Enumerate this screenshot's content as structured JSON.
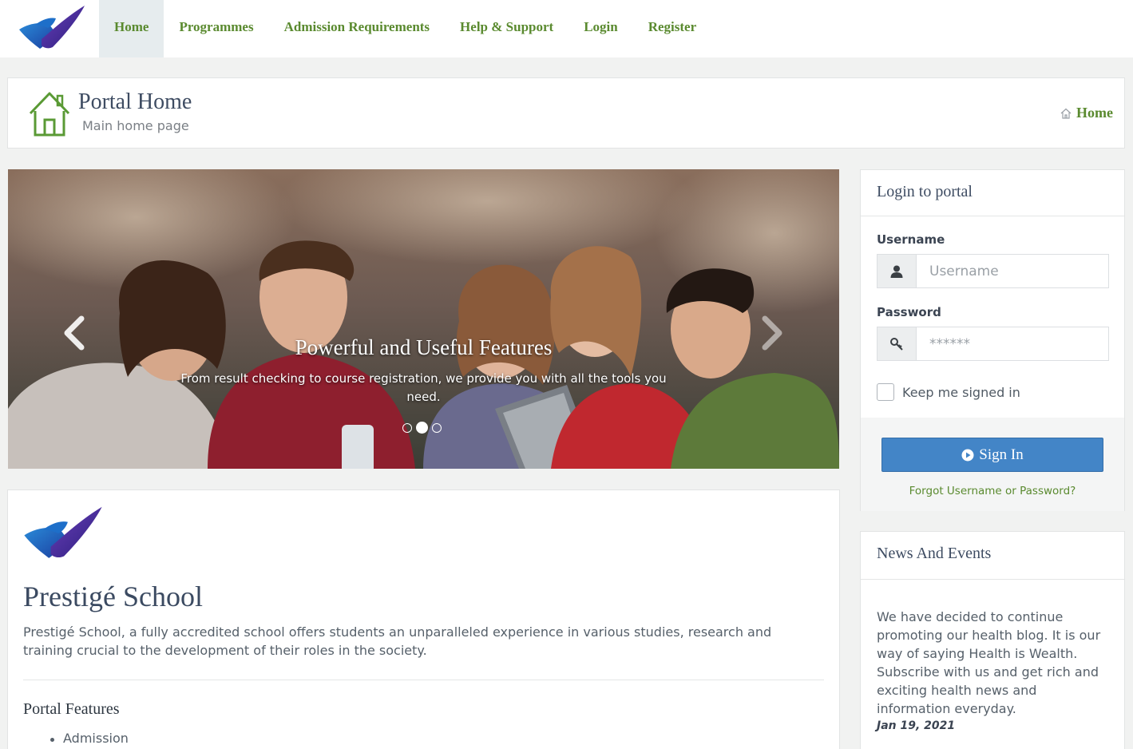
{
  "nav": {
    "items": [
      {
        "label": "Home",
        "active": true
      },
      {
        "label": "Programmes",
        "active": false
      },
      {
        "label": "Admission Requirements",
        "active": false
      },
      {
        "label": "Help & Support",
        "active": false
      },
      {
        "label": "Login",
        "active": false
      },
      {
        "label": "Register",
        "active": false
      }
    ]
  },
  "page_header": {
    "title": "Portal Home",
    "subtitle": "Main home page",
    "breadcrumb": "Home",
    "icon": "house-icon"
  },
  "carousel": {
    "title": "Powerful and Useful Features",
    "text": "From result checking to course registration, we provide you with all the tools you need.",
    "slide_count": 3,
    "active_slide": 2,
    "prev_icon": "chevron-left-icon",
    "next_icon": "chevron-right-icon"
  },
  "about": {
    "school_name": "Prestigé School",
    "description": "Prestigé School, a fully accredited school offers students an unparalleled experience in various studies, research and training crucial to the development of their roles in the society.",
    "features_title": "Portal Features",
    "features": [
      "Admission"
    ]
  },
  "login": {
    "title": "Login to portal",
    "username_label": "Username",
    "username_placeholder": "Username",
    "username_icon": "user-icon",
    "password_label": "Password",
    "password_placeholder": "******",
    "password_icon": "key-icon",
    "remember_label": "Keep me signed in",
    "signin_label": "Sign In",
    "signin_icon": "play-circle-icon",
    "forgot_label": "Forgot Username or Password?"
  },
  "news": {
    "title": "News And Events",
    "body": "We have decided to continue promoting our health blog. It is our way of saying Health is Wealth. Subscribe with us and get rich and exciting health news and information everyday.",
    "date": "Jan 19, 2021"
  },
  "colors": {
    "brand_green": "#5a8a2f",
    "brand_blue": "#4385c7",
    "heading": "#3e4c62",
    "page_bg": "#f1f2f1"
  }
}
